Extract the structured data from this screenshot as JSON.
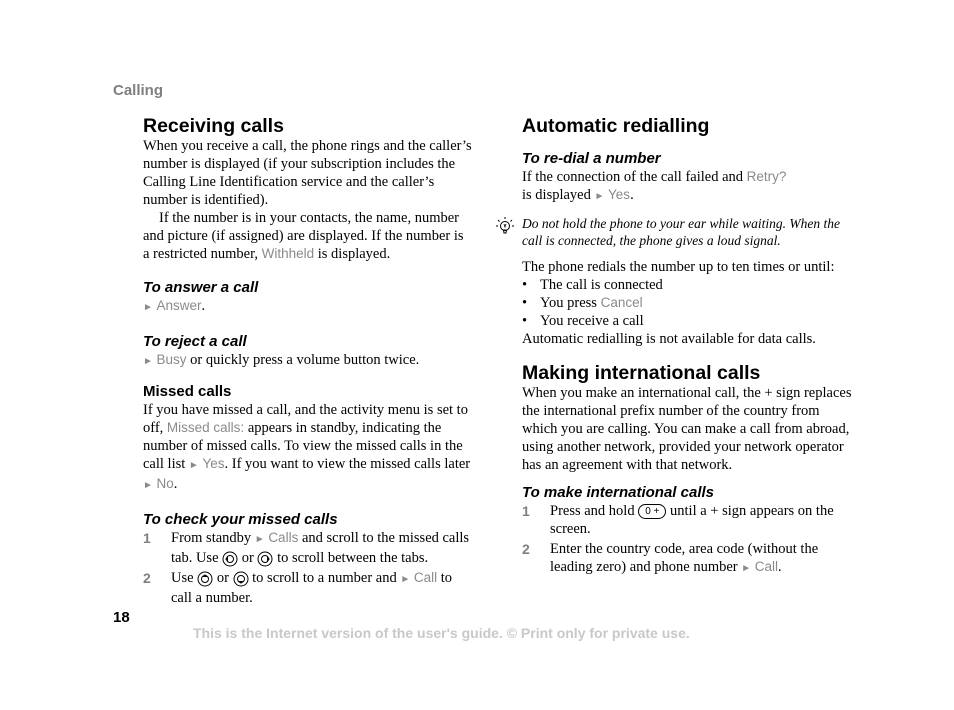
{
  "section_header": "Calling",
  "left": {
    "receiving": {
      "title": "Receiving calls",
      "p1": "When you receive a call, the phone rings and the caller’s number is displayed (if your subscription includes the Calling Line Identification service and the caller’s number is identified).",
      "p2_pre": "If the number is in your contacts, the name, number and picture (if assigned) are displayed. If the number is a restricted number, ",
      "p2_term": "Withheld",
      "p2_post": " is displayed."
    },
    "answer": {
      "title": "To answer a call",
      "term": "Answer",
      "post": "."
    },
    "reject": {
      "title": "To reject a call",
      "term": "Busy",
      "post": " or quickly press a volume button twice."
    },
    "missed": {
      "title": "Missed calls",
      "t1": "If you have missed a call, and the activity menu is set to off, ",
      "term1": "Missed calls:",
      "t2": " appears in standby, indicating the number of missed calls. To view the missed calls in the call list ",
      "term2": "Yes",
      "t3": ". If you want to view the missed calls later ",
      "term3": "No",
      "t4": "."
    },
    "check": {
      "title": "To check your missed calls",
      "steps": [
        {
          "num": "1",
          "a": "From standby ",
          "term": "Calls",
          "b": " and scroll to the missed calls tab. Use ",
          "or": " or ",
          "c": " to scroll between the tabs."
        },
        {
          "num": "2",
          "a": "Use ",
          "or": " or ",
          "b": " to scroll to a number and ",
          "term": "Call",
          "c": " to call a number."
        }
      ]
    }
  },
  "right": {
    "auto": {
      "title": "Automatic redialling",
      "sub": "To re-dial a number",
      "p1": "If the connection of the call failed and ",
      "term1": "Retry?",
      "p1b": " is displayed ",
      "term2": "Yes",
      "p1c": ".",
      "tip": "Do not hold the phone to your ear while waiting. When the call is connected, the phone gives a loud signal.",
      "p2": "The phone redials the number up to ten times or until:",
      "bullets": [
        {
          "text": "The call is connected",
          "term": ""
        },
        {
          "text": "You press ",
          "term": "Cancel"
        },
        {
          "text": "You receive a call",
          "term": ""
        }
      ],
      "p3": "Automatic redialling is not available for data calls."
    },
    "intl": {
      "title": "Making international calls",
      "p1": "When you make an international call, the + sign replaces the international prefix number of the country from which you are calling. You can make a call from abroad, using another network, provided your network operator has an agreement with that network.",
      "sub": "To make international calls",
      "steps": [
        {
          "num": "1",
          "a": "Press and hold ",
          "key": "0 +",
          "b": " until a + sign appears on the screen."
        },
        {
          "num": "2",
          "a": "Enter the country code, area code (without the leading zero) and phone number ",
          "term": "Call",
          "b": "."
        }
      ]
    }
  },
  "page_number": "18",
  "footer": "This is the Internet version of the user's guide. © Print only for private use.",
  "arrow_glyph": "►",
  "bullet_glyph": "•"
}
